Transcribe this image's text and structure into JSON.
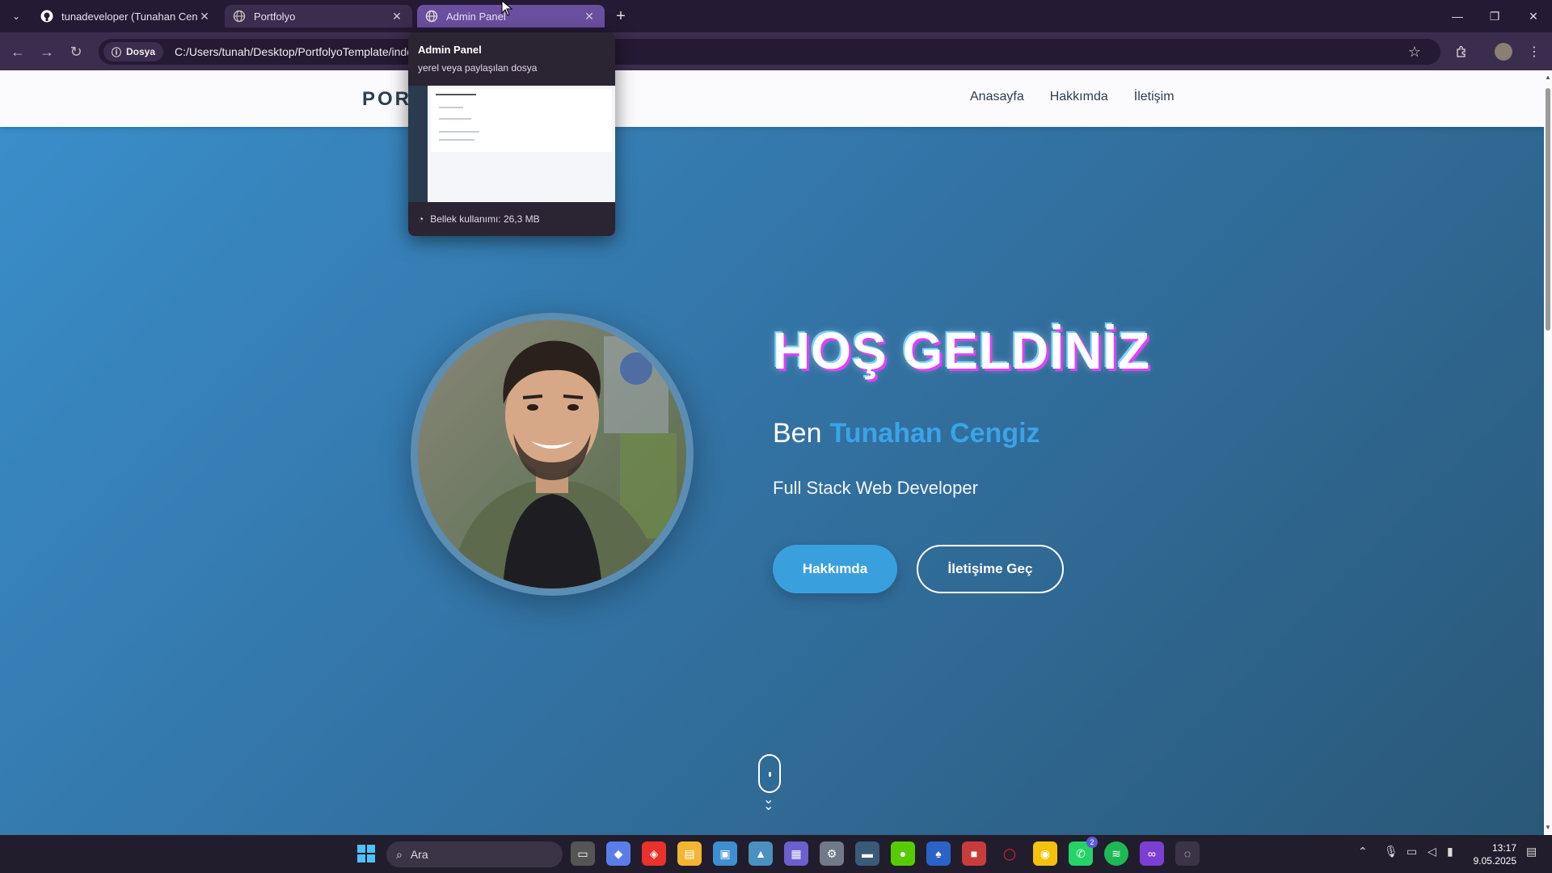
{
  "browser": {
    "tabs": [
      {
        "title": "tunadeveloper (Tunahan Cengiz)",
        "favicon": "github-icon"
      },
      {
        "title": "Portfolyo",
        "favicon": "globe-icon"
      },
      {
        "title": "Admin Panel",
        "favicon": "globe-icon",
        "active": true
      }
    ],
    "address": {
      "chip_label": "Dosya",
      "url": "C:/Users/tunah/Desktop/PortfolyoTemplate/index.html"
    },
    "hover_card": {
      "title": "Admin Panel",
      "subtitle": "yerel veya paylaşılan dosya",
      "memory": "Bellek kullanımı: 26,3 MB"
    }
  },
  "site": {
    "brand": "PORTFOLYO",
    "nav": [
      "Anasayfa",
      "Hakkımda",
      "İletişim"
    ],
    "hero": {
      "title": "HOŞ GELDİNİZ",
      "greeting": "Ben",
      "name": "Tunahan Cengiz",
      "role": "Full Stack Web Developer",
      "primary_button": "Hakkımda",
      "secondary_button": "İletişime Geç"
    }
  },
  "taskbar": {
    "search_placeholder": "Ara",
    "time": "13:17",
    "date": "9.05.2025",
    "whatsapp_badge": "2"
  },
  "colors": {
    "accent_blue": "#3aa0dd",
    "hero_gradient_start": "#3a8fcc",
    "hero_gradient_end": "#2a5878",
    "tab_active": "#6a4fa0"
  }
}
